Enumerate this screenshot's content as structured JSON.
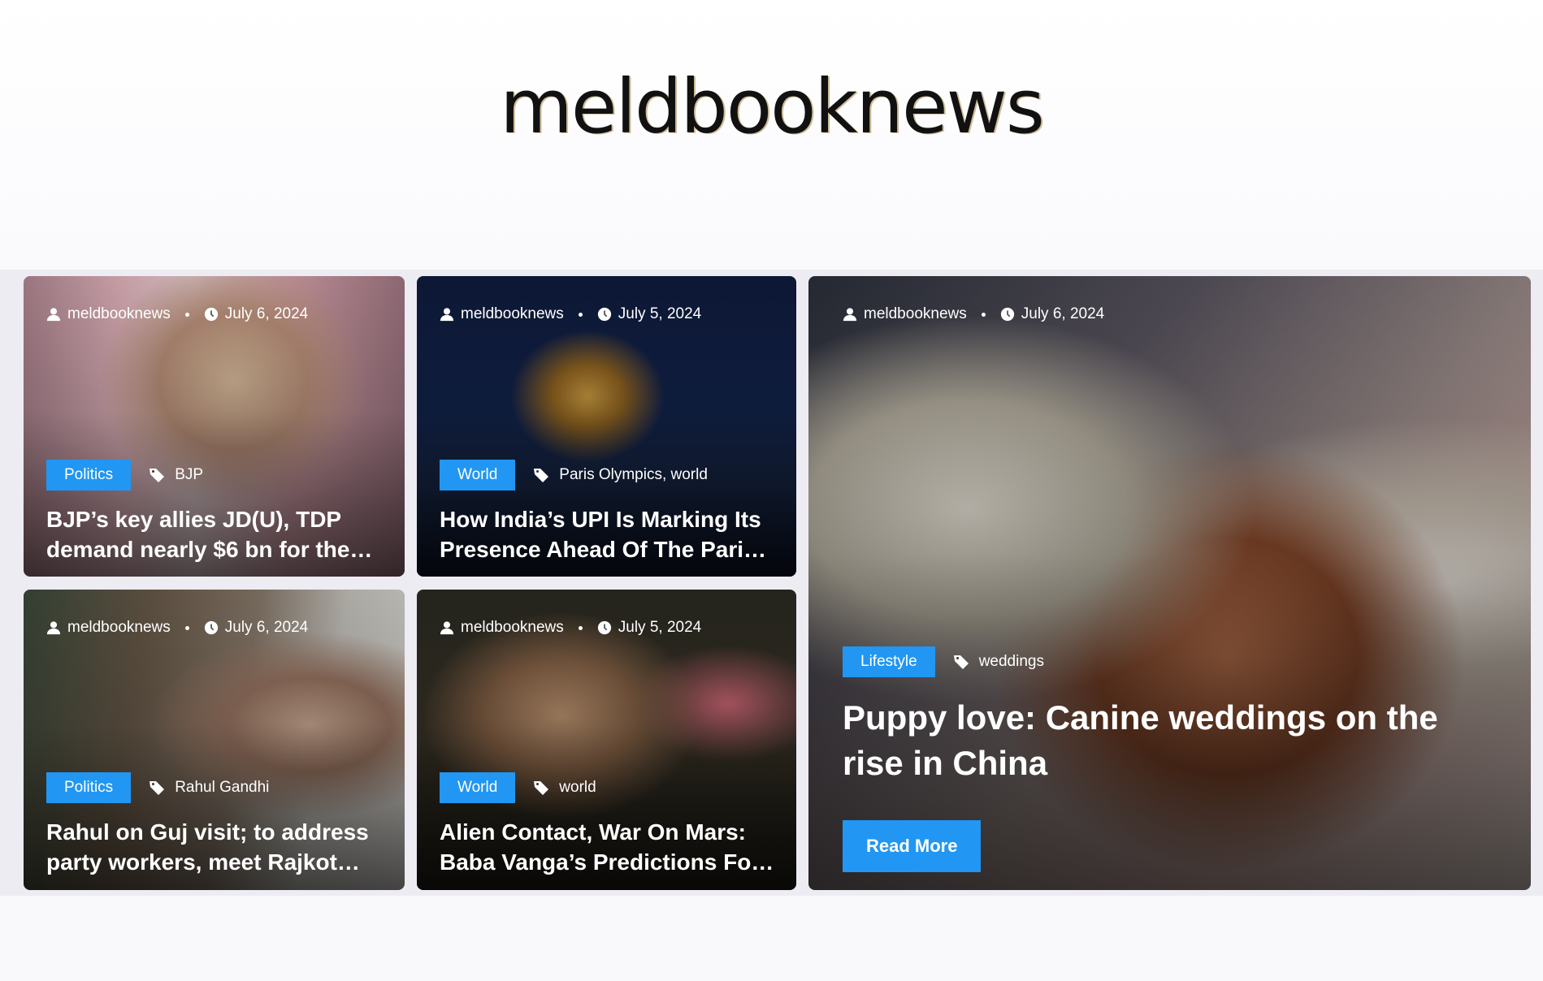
{
  "site": {
    "logo": "meldbooknews"
  },
  "colors": {
    "accent": "#2196f3",
    "header_bg": "#ffffff",
    "band_bg": "#ececf2"
  },
  "posts": [
    {
      "author": "meldbooknews",
      "date": "July 6, 2024",
      "category": "Politics",
      "tags": "BJP",
      "title": "BJP’s key allies JD(U), TDP demand nearly $6 bn for the…"
    },
    {
      "author": "meldbooknews",
      "date": "July 5, 2024",
      "category": "World",
      "tags": "Paris Olympics, world",
      "title": "How India’s UPI Is Marking Its Presence Ahead Of The Pari…"
    },
    {
      "author": "meldbooknews",
      "date": "July 6, 2024",
      "category": "Politics",
      "tags": "Rahul Gandhi",
      "title": "Rahul on Guj visit; to address party workers, meet Rajkot…"
    },
    {
      "author": "meldbooknews",
      "date": "July 5, 2024",
      "category": "World",
      "tags": "world",
      "title": "Alien Contact, War On Mars: Baba Vanga’s Predictions Fo…"
    }
  ],
  "featured": {
    "author": "meldbooknews",
    "date": "July 6, 2024",
    "category": "Lifestyle",
    "tags": "weddings",
    "title": "Puppy love: Canine weddings on the rise in China",
    "read_more": "Read More"
  },
  "icons": {
    "author": "user-icon",
    "date": "clock-icon",
    "tag": "tag-icon"
  }
}
